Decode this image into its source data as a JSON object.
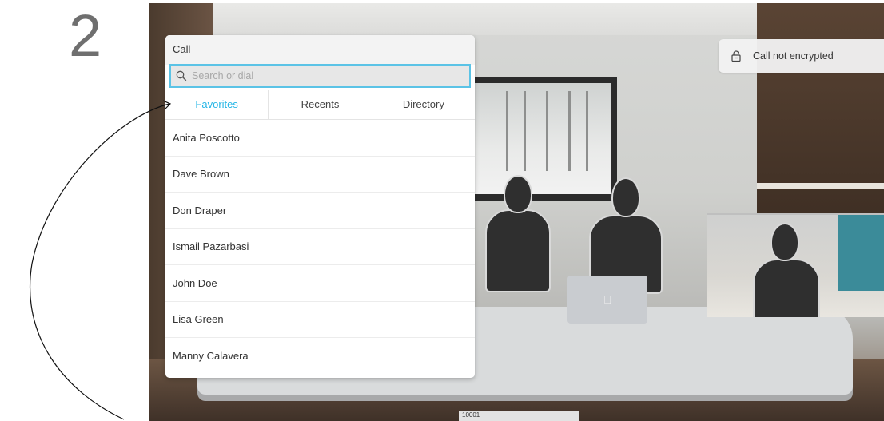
{
  "step": {
    "number": "2"
  },
  "call_panel": {
    "title": "Call",
    "search_placeholder": "Search or dial",
    "tabs": [
      {
        "label": "Favorites",
        "active": true
      },
      {
        "label": "Recents",
        "active": false
      },
      {
        "label": "Directory",
        "active": false
      }
    ],
    "contacts": [
      "Anita Poscotto",
      "Dave Brown",
      "Don Draper",
      "Ismail Pazarbasi",
      "John Doe",
      "Lisa Green",
      "Manny Calavera"
    ]
  },
  "encryption_status": {
    "text": "Call not encrypted",
    "icon": "lock-open-icon"
  },
  "bottom_bar": {
    "text": "10001"
  },
  "colors": {
    "accent": "#26b6e6",
    "search_border": "#5bc3e6"
  }
}
